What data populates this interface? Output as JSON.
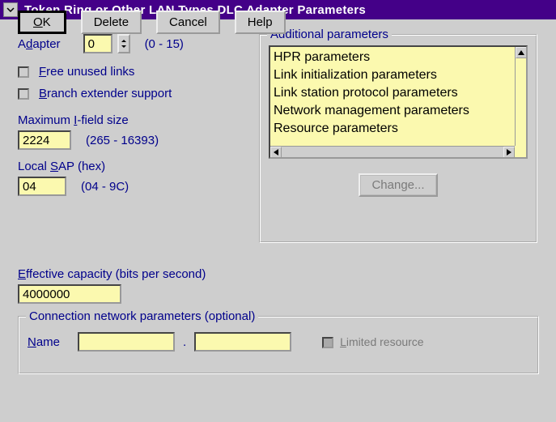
{
  "window": {
    "title": "Token Ring or Other LAN Types DLC Adapter Parameters"
  },
  "adapter": {
    "label_pre": "A",
    "label_u": "d",
    "label_post": "apter",
    "value": "0",
    "range": "(0 - 15)"
  },
  "free_links": {
    "u": "F",
    "post": "ree unused links"
  },
  "branch_ext": {
    "u": "B",
    "post": "ranch extender support"
  },
  "ifield": {
    "label_pre": "Maximum ",
    "label_u": "I",
    "label_post": "-field size",
    "value": "2224",
    "range": "(265 - 16393)"
  },
  "sap": {
    "label_pre": "Local ",
    "label_u": "S",
    "label_post": "AP (hex)",
    "value": "04",
    "range": "(04 - 9C)"
  },
  "additional": {
    "title": "Additional parameters",
    "items": [
      "HPR parameters",
      "Link initialization parameters",
      "Link station protocol parameters",
      "Network management parameters",
      "Resource parameters"
    ],
    "change_label": "Change..."
  },
  "capacity": {
    "label_u": "E",
    "label_post": "ffective capacity (bits per second)",
    "value": "4000000"
  },
  "conn": {
    "title": "Connection network parameters (optional)",
    "name_u": "N",
    "name_post": "ame",
    "name1": "",
    "name2": "",
    "dot": ".",
    "limited_u": "L",
    "limited_post": "imited resource"
  },
  "buttons": {
    "ok_u": "O",
    "ok_post": "K",
    "delete": "Delete",
    "cancel": "Cancel",
    "help": "Help"
  }
}
